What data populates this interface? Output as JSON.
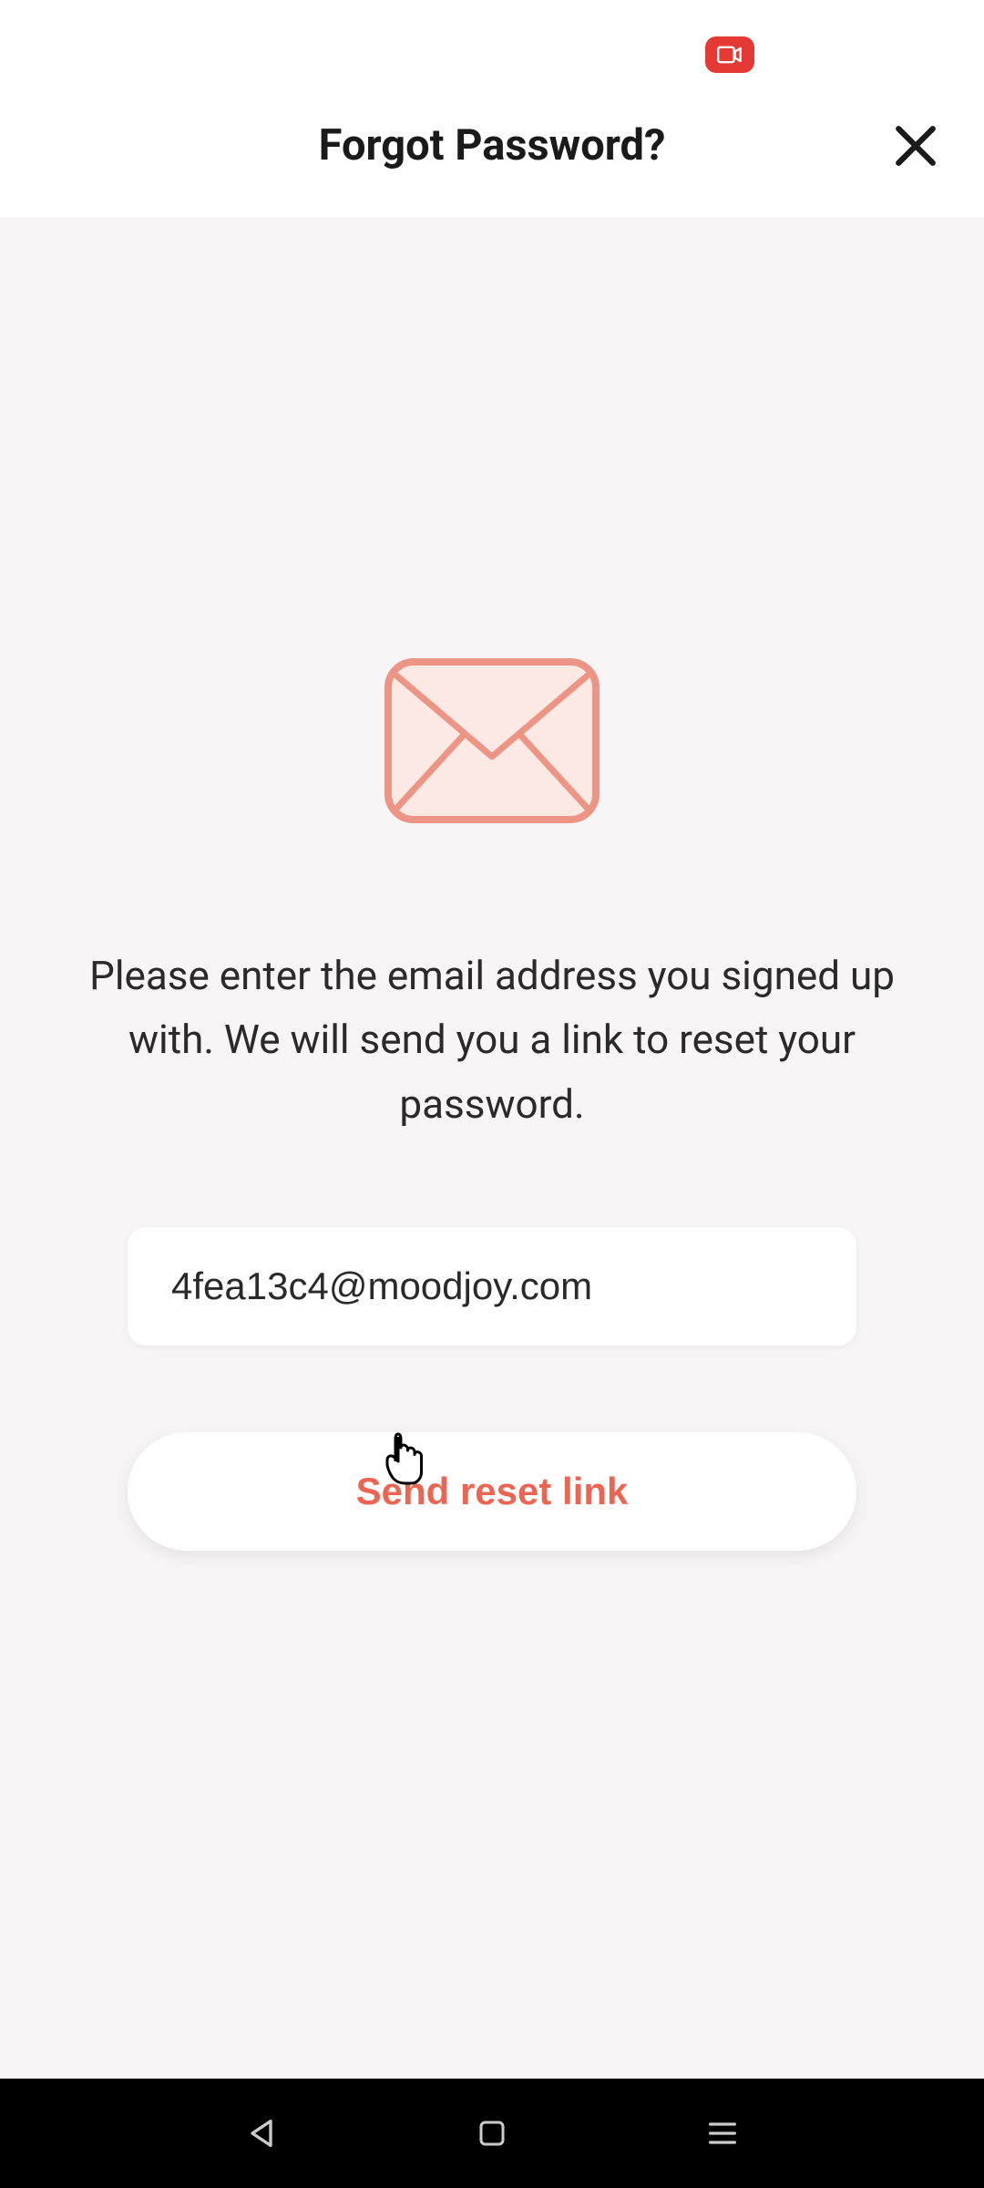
{
  "header": {
    "title": "Forgot Password?"
  },
  "content": {
    "instruction": "Please enter the email address you signed up with. We will send you a link to reset your password.",
    "email_value": "4fea13c4@moodjoy.com",
    "button_label": "Send reset link"
  },
  "colors": {
    "accent": "#ec6552",
    "envelope_fill": "#fce9e3",
    "envelope_stroke": "#ec9485"
  }
}
